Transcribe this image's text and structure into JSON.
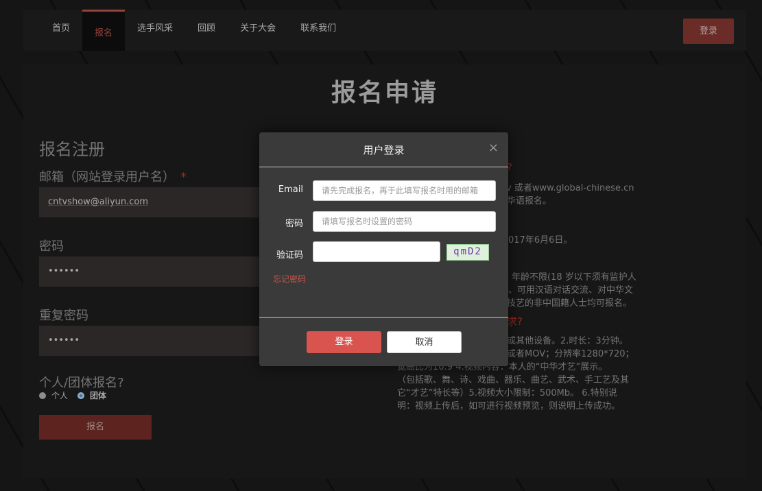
{
  "nav": {
    "items": [
      {
        "label": "首页"
      },
      {
        "label": "报名"
      },
      {
        "label": "选手风采"
      },
      {
        "label": "回顾"
      },
      {
        "label": "关于大会"
      },
      {
        "label": "联系我们"
      }
    ],
    "active_index": 1,
    "login_label": "登录"
  },
  "page": {
    "title": "报名申请"
  },
  "form": {
    "heading": "报名注册",
    "email_label": "邮箱（网站登录用户名）",
    "required_mark": "*",
    "email_value": "cntvshow@aliyun.com",
    "password_label": "密码",
    "password_value": "••••••",
    "repeat_label": "重复密码",
    "repeat_value": "••••••",
    "type_label": "个人/团体报名?",
    "option_personal": "个人",
    "option_group": "团体",
    "selected_option": "团体",
    "submit_label": "报名"
  },
  "right": {
    "lines": [
      "?",
      "v 或者www.global-chinese.cn",
      "华语报名。",
      "017年6月6日。",
      "年龄不限(18 岁以下须有监护人",
      "、可用汉语对话交流、对中华文",
      "技艺的非中国籍人士均可报名。",
      "求?",
      "或其他设备。2.时长：3分钟。",
      "或者MOV；分辨率1280*720；",
      "宽高比为16:9  4.视频内容：本人的“中华才艺”展示。",
      "（包括歌、舞、诗、戏曲、器乐、曲艺、武术、手工艺及其",
      "它“才艺”特长等）5.视频大小限制：500Mb。 6.特别说",
      "明：视频上传后，如可进行视频预览，则说明上传成功。"
    ]
  },
  "modal": {
    "title": "用户登录",
    "close": "×",
    "email_label": "Email",
    "email_placeholder": "请先完成报名，再于此填写报名时用的邮箱",
    "password_label": "密码",
    "password_placeholder": "请填写报名时设置的密码",
    "captcha_label": "验证码",
    "captcha_value": "",
    "captcha_text": "qmD2",
    "forgot_label": "忘记密码",
    "login_label": "登录",
    "cancel_label": "取消"
  },
  "colors": {
    "accent": "#c9584e",
    "dark_accent": "#8f3a33",
    "modal_bg": "#3a3a3a"
  }
}
